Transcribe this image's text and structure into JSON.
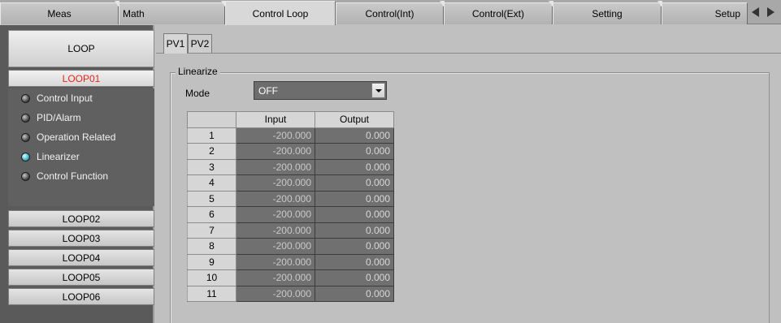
{
  "tabs": [
    {
      "label": "Meas",
      "active": false
    },
    {
      "label": "Math",
      "active": false
    },
    {
      "label": "Control Loop",
      "active": true
    },
    {
      "label": "Control(Int)",
      "active": false
    },
    {
      "label": "Control(Ext)",
      "active": false
    },
    {
      "label": "Setting",
      "active": false
    },
    {
      "label": "Setup",
      "active": false
    }
  ],
  "sidebar": {
    "header": "LOOP",
    "active_loop": "LOOP01",
    "menu": [
      {
        "label": "Control Input",
        "icon": "led-off-icon"
      },
      {
        "label": "PID/Alarm",
        "icon": "led-off-icon"
      },
      {
        "label": "Operation Related",
        "icon": "led-off-icon"
      },
      {
        "label": "Linearizer",
        "icon": "led-on-icon"
      },
      {
        "label": "Control Function",
        "icon": "led-off-icon"
      }
    ],
    "loops": [
      "LOOP02",
      "LOOP03",
      "LOOP04",
      "LOOP05",
      "LOOP06"
    ]
  },
  "main": {
    "subtabs": [
      "PV1",
      "PV2"
    ],
    "group_title": "Linearize",
    "mode_label": "Mode",
    "mode_value": "OFF",
    "table": {
      "headers": [
        "",
        "Input",
        "Output"
      ],
      "rows": [
        [
          "1",
          "-200.000",
          "0.000"
        ],
        [
          "2",
          "-200.000",
          "0.000"
        ],
        [
          "3",
          "-200.000",
          "0.000"
        ],
        [
          "4",
          "-200.000",
          "0.000"
        ],
        [
          "5",
          "-200.000",
          "0.000"
        ],
        [
          "6",
          "-200.000",
          "0.000"
        ],
        [
          "7",
          "-200.000",
          "0.000"
        ],
        [
          "8",
          "-200.000",
          "0.000"
        ],
        [
          "9",
          "-200.000",
          "0.000"
        ],
        [
          "10",
          "-200.000",
          "0.000"
        ],
        [
          "11",
          "-200.000",
          "0.000"
        ]
      ]
    }
  },
  "colors": {
    "active_loop_text": "#e8251a",
    "led_on": "#29a3b8",
    "sidebar_bg": "#5a5a5a",
    "cell_bg": "#707070"
  }
}
